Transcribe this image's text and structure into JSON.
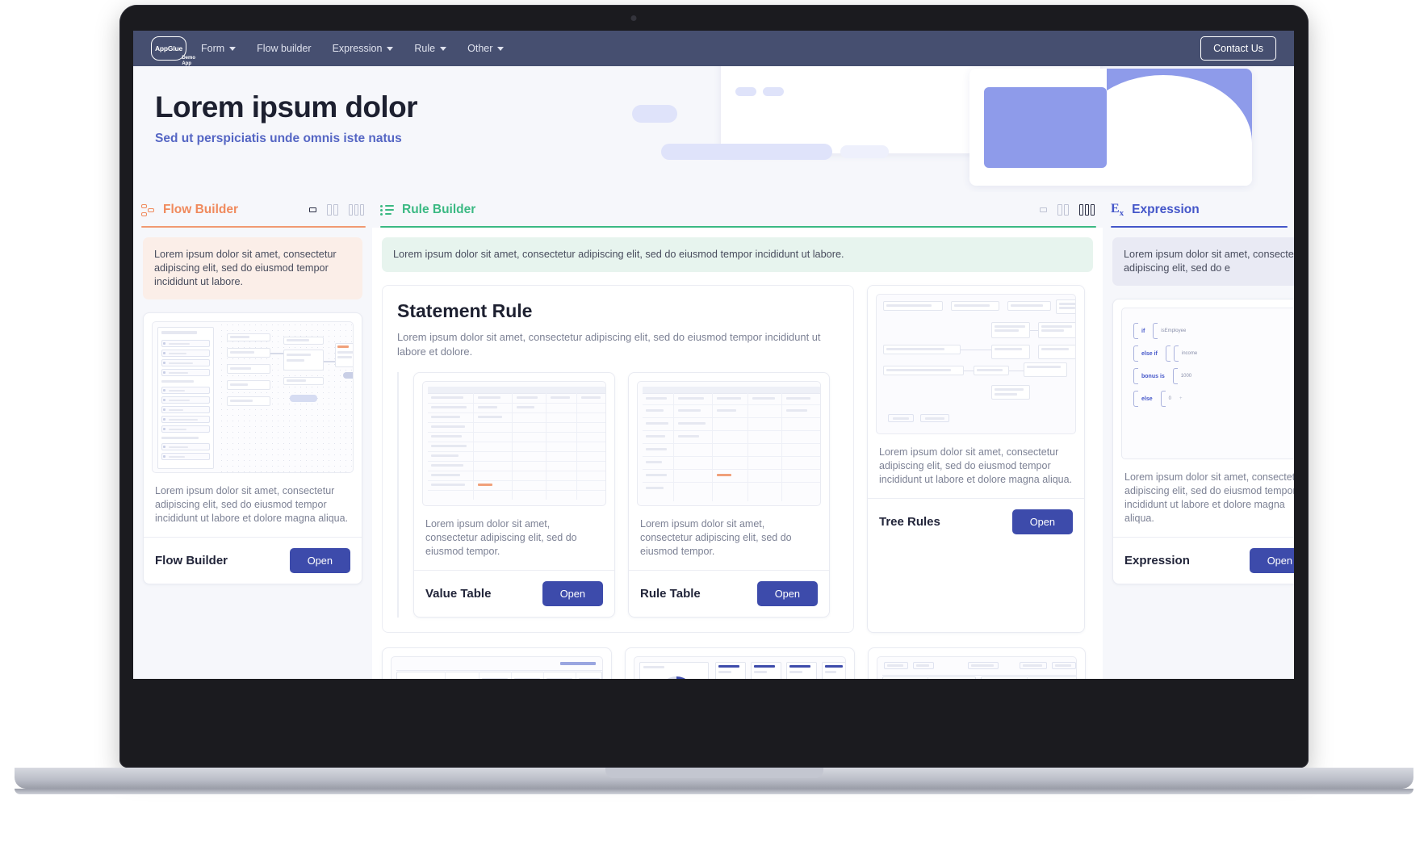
{
  "nav": {
    "logo": {
      "main": "AppGlue",
      "sub_line1": "Demo",
      "sub_line2": "App",
      "icon": "appglue-logo"
    },
    "items": [
      {
        "label": "Form",
        "has_caret": true
      },
      {
        "label": "Flow builder",
        "has_caret": false
      },
      {
        "label": "Expression",
        "has_caret": true
      },
      {
        "label": "Rule",
        "has_caret": true
      },
      {
        "label": "Other",
        "has_caret": true
      }
    ],
    "contact_label": "Contact Us",
    "bar_color": "#464f70"
  },
  "hero": {
    "title": "Lorem ipsum dolor",
    "subtitle": "Sed ut perspiciatis unde omnis iste natus",
    "subtitle_color": "#5566c4"
  },
  "tabs": [
    {
      "id": "flow",
      "label": "Flow Builder",
      "icon": "flow-builder-icon",
      "color": "#f08a5d",
      "active_layout": 1
    },
    {
      "id": "rule",
      "label": "Rule Builder",
      "icon": "rule-builder-icon",
      "color": "#3bb983",
      "active_layout": 3
    },
    {
      "id": "expression",
      "label": "Expression",
      "icon": "expression-ex-icon",
      "color": "#4456c9",
      "active_layout": 0
    }
  ],
  "layout_icons": [
    {
      "name": "layout-single-icon"
    },
    {
      "name": "layout-two-column-icon"
    },
    {
      "name": "layout-three-column-icon"
    }
  ],
  "columns": {
    "flow": {
      "note": "Lorem ipsum dolor sit amet, consectetur adipiscing elit, sed do eiusmod tempor incididunt ut labore.",
      "card": {
        "thumb": "flow-builder-canvas-thumbnail",
        "desc": "Lorem ipsum dolor sit amet, consectetur adipiscing elit, sed do eiusmod tempor incididunt ut labore et dolore magna aliqua.",
        "name": "Flow Builder",
        "open_label": "Open"
      }
    },
    "rule": {
      "note": "Lorem ipsum dolor sit amet, consectetur adipiscing elit, sed do eiusmod tempor incididunt ut labore.",
      "statement": {
        "title": "Statement Rule",
        "desc": "Lorem ipsum dolor sit amet, consectetur adipiscing elit, sed do eiusmod tempor incididunt ut labore et dolore."
      },
      "sub_cards": [
        {
          "thumb": "value-table-thumbnail",
          "desc": "Lorem ipsum dolor sit amet, consectetur adipiscing elit, sed do eiusmod tempor.",
          "name": "Value Table",
          "open_label": "Open"
        },
        {
          "thumb": "rule-table-thumbnail",
          "desc": "Lorem ipsum dolor sit amet, consectetur adipiscing elit, sed do eiusmod tempor.",
          "name": "Rule Table",
          "open_label": "Open"
        }
      ],
      "bottom_cards": [
        {
          "thumb": "intersection-table-thumbnail"
        },
        {
          "thumb": "rule-set-dashboard-thumbnail"
        }
      ]
    },
    "tree": {
      "card": {
        "thumb": "tree-rules-diagram-thumbnail",
        "desc": "Lorem ipsum dolor sit amet, consectetur adipiscing elit, sed do eiusmod tempor incididunt ut labore et dolore magna aliqua.",
        "name": "Tree Rules",
        "open_label": "Open"
      },
      "bottom_card": {
        "thumb": "rule-list-table-thumbnail"
      }
    },
    "expression": {
      "note": "Lorem ipsum dolor sit amet, consectetur adipiscing elit, sed do e",
      "card": {
        "thumb": "expression-builder-thumbnail",
        "desc": "Lorem ipsum dolor sit amet, consectetur adipiscing elit, sed do eiusmod tempor incididunt ut labore et dolore magna aliqua.",
        "name": "Expression",
        "open_label": "Open"
      },
      "builder_rows": [
        {
          "keyword": "if",
          "value": "isEmployee"
        },
        {
          "keyword": "else if",
          "value": "income"
        },
        {
          "keyword": "bonus is",
          "value": "1000"
        },
        {
          "keyword": "else",
          "value": "0"
        }
      ]
    }
  },
  "colors": {
    "accent_blue": "#3d4bab",
    "flow_orange": "#f08a5d",
    "rule_green": "#3bb983",
    "expr_blue": "#4456c9",
    "page_bg": "#f6f7fb",
    "nav_bg": "#464f70"
  }
}
